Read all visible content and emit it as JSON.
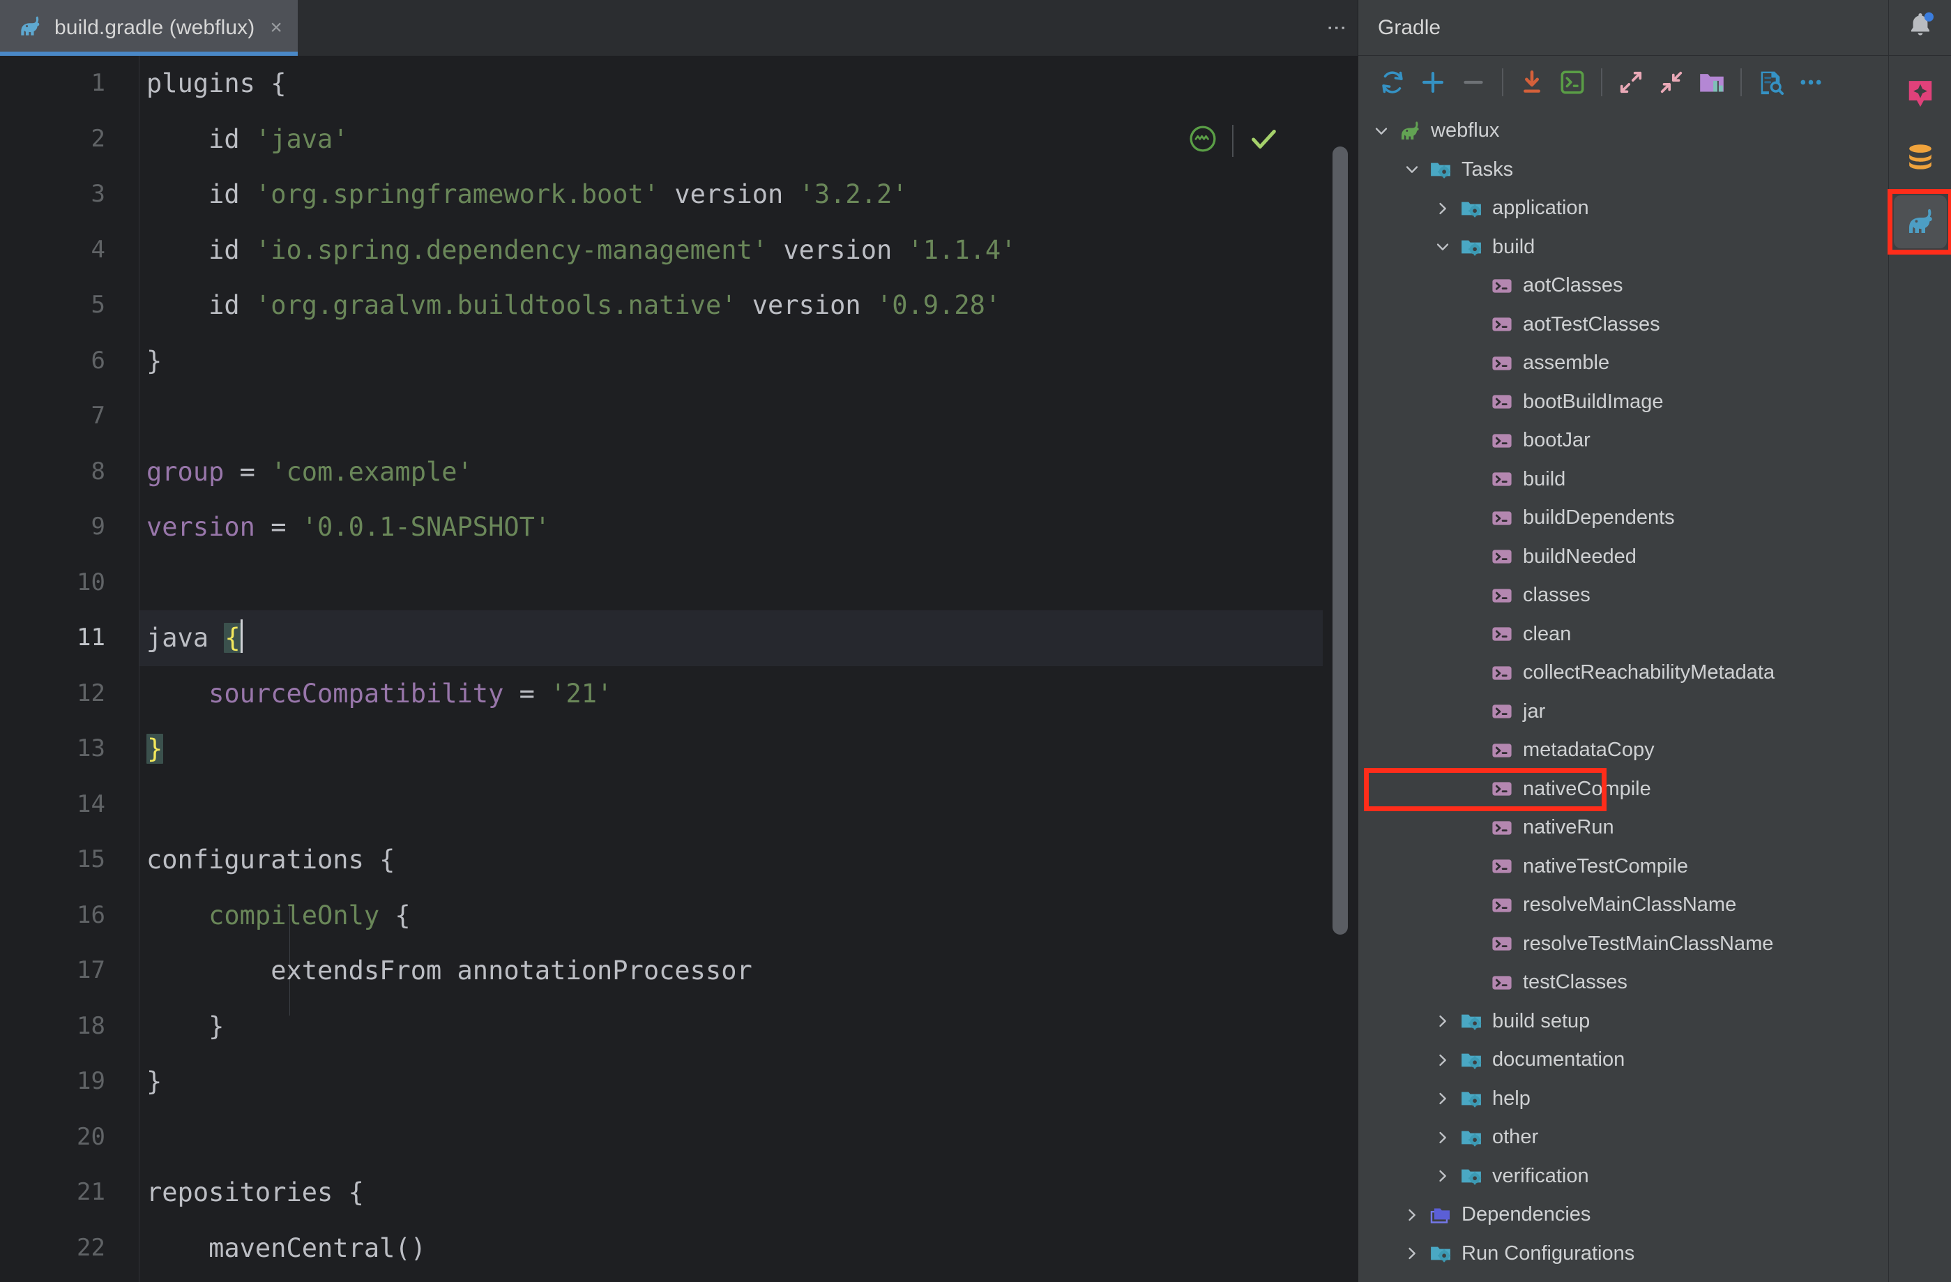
{
  "editor": {
    "tab": {
      "icon": "gradle-elephant-icon",
      "title": "build.gradle (webflux)",
      "close_glyph": "×",
      "kebab_glyph": "⋮",
      "underline_color": "#4a88c7"
    },
    "widgets": {
      "inspections_icon": "inspections-widget-icon",
      "check_icon": "analysis-ok-check-icon"
    },
    "current_line": 11,
    "lines": [
      {
        "n": 1,
        "tokens": [
          {
            "t": "plugins {",
            "c": "plain"
          }
        ]
      },
      {
        "n": 2,
        "tokens": [
          {
            "t": "    id ",
            "c": "plain"
          },
          {
            "t": "'java'",
            "c": "str"
          }
        ]
      },
      {
        "n": 3,
        "tokens": [
          {
            "t": "    id ",
            "c": "plain"
          },
          {
            "t": "'org.springframework.boot'",
            "c": "str"
          },
          {
            "t": " version ",
            "c": "plain"
          },
          {
            "t": "'3.2.2'",
            "c": "str"
          }
        ]
      },
      {
        "n": 4,
        "tokens": [
          {
            "t": "    id ",
            "c": "plain"
          },
          {
            "t": "'io.spring.dependency-management'",
            "c": "str"
          },
          {
            "t": " version ",
            "c": "plain"
          },
          {
            "t": "'1.1.4'",
            "c": "str"
          }
        ]
      },
      {
        "n": 5,
        "tokens": [
          {
            "t": "    id ",
            "c": "plain"
          },
          {
            "t": "'org.graalvm.buildtools.native'",
            "c": "str"
          },
          {
            "t": " version ",
            "c": "plain"
          },
          {
            "t": "'0.9.28'",
            "c": "str"
          }
        ]
      },
      {
        "n": 6,
        "tokens": [
          {
            "t": "}",
            "c": "plain"
          }
        ]
      },
      {
        "n": 7,
        "tokens": [
          {
            "t": "",
            "c": "plain"
          }
        ]
      },
      {
        "n": 8,
        "tokens": [
          {
            "t": "group",
            "c": "purp"
          },
          {
            "t": " = ",
            "c": "plain"
          },
          {
            "t": "'com.example'",
            "c": "str"
          }
        ]
      },
      {
        "n": 9,
        "tokens": [
          {
            "t": "version",
            "c": "purp"
          },
          {
            "t": " = ",
            "c": "plain"
          },
          {
            "t": "'0.0.1-SNAPSHOT'",
            "c": "str"
          }
        ]
      },
      {
        "n": 10,
        "tokens": [
          {
            "t": "",
            "c": "plain"
          }
        ]
      },
      {
        "n": 11,
        "tokens": [
          {
            "t": "java ",
            "c": "plain"
          },
          {
            "t": "{",
            "c": "brace"
          },
          {
            "t": "",
            "c": "caret"
          }
        ]
      },
      {
        "n": 12,
        "tokens": [
          {
            "t": "    sourceCompatibility",
            "c": "purp"
          },
          {
            "t": " = ",
            "c": "plain"
          },
          {
            "t": "'21'",
            "c": "str"
          }
        ]
      },
      {
        "n": 13,
        "tokens": [
          {
            "t": "}",
            "c": "brace"
          }
        ]
      },
      {
        "n": 14,
        "tokens": [
          {
            "t": "",
            "c": "plain"
          }
        ]
      },
      {
        "n": 15,
        "tokens": [
          {
            "t": "configurations {",
            "c": "plain"
          }
        ]
      },
      {
        "n": 16,
        "tokens": [
          {
            "t": "    ",
            "c": "plain"
          },
          {
            "t": "compileOnly",
            "c": "olive"
          },
          {
            "t": " {",
            "c": "plain"
          }
        ]
      },
      {
        "n": 17,
        "tokens": [
          {
            "t": "        extendsFrom annotationProcessor",
            "c": "plain"
          }
        ]
      },
      {
        "n": 18,
        "tokens": [
          {
            "t": "    }",
            "c": "plain"
          }
        ]
      },
      {
        "n": 19,
        "tokens": [
          {
            "t": "}",
            "c": "plain"
          }
        ]
      },
      {
        "n": 20,
        "tokens": [
          {
            "t": "",
            "c": "plain"
          }
        ]
      },
      {
        "n": 21,
        "tokens": [
          {
            "t": "repositories {",
            "c": "plain"
          }
        ]
      },
      {
        "n": 22,
        "tokens": [
          {
            "t": "    mavenCentral()",
            "c": "plain"
          }
        ]
      }
    ]
  },
  "gradle": {
    "title": "Gradle",
    "toolbar": [
      {
        "name": "reload-all-gradle-projects-icon",
        "label": "Reload All Gradle Projects"
      },
      {
        "name": "link-gradle-project-icon",
        "label": "Link Gradle Project"
      },
      {
        "name": "detach-external-project-icon",
        "label": "Detach External Project"
      },
      {
        "name": "sep"
      },
      {
        "name": "download-sources-icon",
        "label": "Download Sources"
      },
      {
        "name": "execute-gradle-task-icon",
        "label": "Execute Gradle Task"
      },
      {
        "name": "sep"
      },
      {
        "name": "expand-all-icon",
        "label": "Expand All"
      },
      {
        "name": "collapse-all-icon",
        "label": "Collapse All"
      },
      {
        "name": "show-ignored-modules-icon",
        "label": "Show Ignored Modules"
      },
      {
        "name": "sep"
      },
      {
        "name": "gradle-settings-icon",
        "label": "Gradle Settings"
      },
      {
        "name": "more-options-icon",
        "label": "More Options"
      }
    ],
    "tree": [
      {
        "label": "webflux",
        "depth": 0,
        "chev": "down",
        "icon": "gradle-elephant-green-icon"
      },
      {
        "label": "Tasks",
        "depth": 1,
        "chev": "down",
        "icon": "task-group-folder-icon"
      },
      {
        "label": "application",
        "depth": 2,
        "chev": "right",
        "icon": "task-group-folder-icon"
      },
      {
        "label": "build",
        "depth": 2,
        "chev": "down",
        "icon": "task-group-folder-icon"
      },
      {
        "label": "aotClasses",
        "depth": 3,
        "chev": "none",
        "icon": "gradle-task-icon"
      },
      {
        "label": "aotTestClasses",
        "depth": 3,
        "chev": "none",
        "icon": "gradle-task-icon"
      },
      {
        "label": "assemble",
        "depth": 3,
        "chev": "none",
        "icon": "gradle-task-icon"
      },
      {
        "label": "bootBuildImage",
        "depth": 3,
        "chev": "none",
        "icon": "gradle-task-icon"
      },
      {
        "label": "bootJar",
        "depth": 3,
        "chev": "none",
        "icon": "gradle-task-icon"
      },
      {
        "label": "build",
        "depth": 3,
        "chev": "none",
        "icon": "gradle-task-icon"
      },
      {
        "label": "buildDependents",
        "depth": 3,
        "chev": "none",
        "icon": "gradle-task-icon"
      },
      {
        "label": "buildNeeded",
        "depth": 3,
        "chev": "none",
        "icon": "gradle-task-icon"
      },
      {
        "label": "classes",
        "depth": 3,
        "chev": "none",
        "icon": "gradle-task-icon"
      },
      {
        "label": "clean",
        "depth": 3,
        "chev": "none",
        "icon": "gradle-task-icon"
      },
      {
        "label": "collectReachabilityMetadata",
        "depth": 3,
        "chev": "none",
        "icon": "gradle-task-icon"
      },
      {
        "label": "jar",
        "depth": 3,
        "chev": "none",
        "icon": "gradle-task-icon"
      },
      {
        "label": "metadataCopy",
        "depth": 3,
        "chev": "none",
        "icon": "gradle-task-icon"
      },
      {
        "label": "nativeCompile",
        "depth": 3,
        "chev": "none",
        "icon": "gradle-task-icon",
        "annotated": true
      },
      {
        "label": "nativeRun",
        "depth": 3,
        "chev": "none",
        "icon": "gradle-task-icon"
      },
      {
        "label": "nativeTestCompile",
        "depth": 3,
        "chev": "none",
        "icon": "gradle-task-icon"
      },
      {
        "label": "resolveMainClassName",
        "depth": 3,
        "chev": "none",
        "icon": "gradle-task-icon"
      },
      {
        "label": "resolveTestMainClassName",
        "depth": 3,
        "chev": "none",
        "icon": "gradle-task-icon"
      },
      {
        "label": "testClasses",
        "depth": 3,
        "chev": "none",
        "icon": "gradle-task-icon"
      },
      {
        "label": "build setup",
        "depth": 2,
        "chev": "right",
        "icon": "task-group-folder-icon"
      },
      {
        "label": "documentation",
        "depth": 2,
        "chev": "right",
        "icon": "task-group-folder-icon"
      },
      {
        "label": "help",
        "depth": 2,
        "chev": "right",
        "icon": "task-group-folder-icon"
      },
      {
        "label": "other",
        "depth": 2,
        "chev": "right",
        "icon": "task-group-folder-icon"
      },
      {
        "label": "verification",
        "depth": 2,
        "chev": "right",
        "icon": "task-group-folder-icon"
      },
      {
        "label": "Dependencies",
        "depth": 1,
        "chev": "right",
        "icon": "dependencies-folder-icon"
      },
      {
        "label": "Run Configurations",
        "depth": 1,
        "chev": "right",
        "icon": "task-group-folder-icon"
      }
    ]
  },
  "right_stripe": {
    "notifications_icon": "notifications-bell-icon",
    "buttons": [
      {
        "name": "ai-assistant-icon",
        "active": false
      },
      {
        "name": "database-icon",
        "active": false
      },
      {
        "name": "gradle-elephant-icon",
        "active": true,
        "annotated": true
      }
    ]
  },
  "colors": {
    "accent_blue": "#4a88c7",
    "annotation_red": "#ff2d1a",
    "string_green": "#6a8759",
    "keyword_purple": "#9876aa",
    "brace_yellow": "#f2e85c",
    "editor_bg": "#1e1f22",
    "panel_bg": "#3c3f41"
  }
}
